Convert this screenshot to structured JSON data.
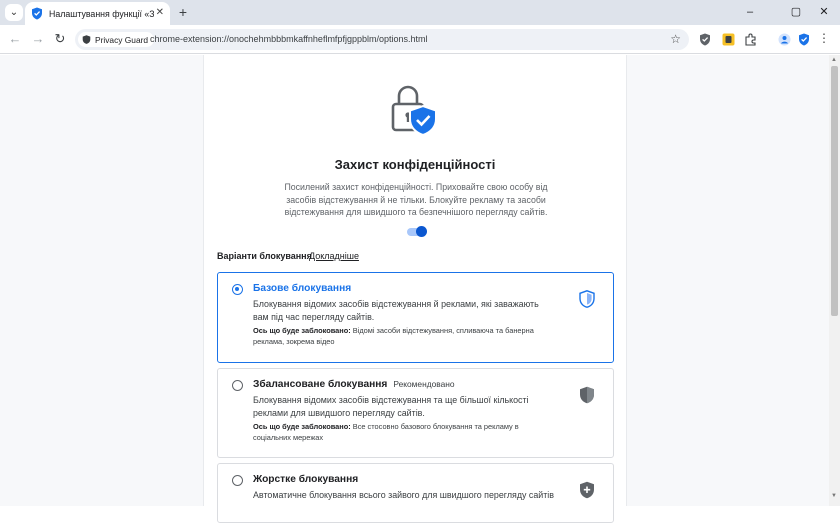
{
  "browser": {
    "tab_title": "Налаштування функції «Захист конфіденційності»",
    "tab_close": "✕",
    "new_tab": "+",
    "window_controls": [
      "–",
      "▢",
      "✕"
    ],
    "site_chip": "Privacy Guard",
    "url": "chrome-extension://onochehmbbbmkaffnheflmfpfjgppblm/options.html",
    "icons": [
      "back-icon",
      "forward-icon",
      "reload-icon",
      "star-icon",
      "shield-extension-icon",
      "yellow-extension-icon",
      "puzzle-icon",
      "profile-icon",
      "privacy-guard-icon",
      "menu-icon"
    ]
  },
  "page": {
    "title": "Захист конфіденційності",
    "description": "Посилений захист конфіденційності. Приховайте свою особу від засобів відстежування й не тільки. Блокуйте рекламу та засоби відстежування для швидшого та безпечнішого перегляду сайтів.",
    "toggle_on": true,
    "section_label": "Варіанти блокування",
    "section_link": "Докладніше",
    "note_prefix": "Ось що буде заблоковано:",
    "options": [
      {
        "title": "Базове блокування",
        "tag": "",
        "description": "Блокування відомих засобів відстежування й реклами, які заважають вам під час перегляду сайтів.",
        "note": "Відомі засоби відстежування, спливаюча та банерна реклама, зокрема відео",
        "selected": true
      },
      {
        "title": "Збалансоване блокування",
        "tag": "Рекомендовано",
        "description": "Блокування відомих засобів відстежування та ще більшої кількості реклами для швидшого перегляду сайтів.",
        "note": "Все стосовно базового блокування та рекламу в соціальних мережах",
        "selected": false
      },
      {
        "title": "Жорстке блокування",
        "tag": "",
        "description": "Автоматичне блокування всього зайвого для швидшого перегляду сайтів",
        "note": "",
        "selected": false
      }
    ]
  }
}
